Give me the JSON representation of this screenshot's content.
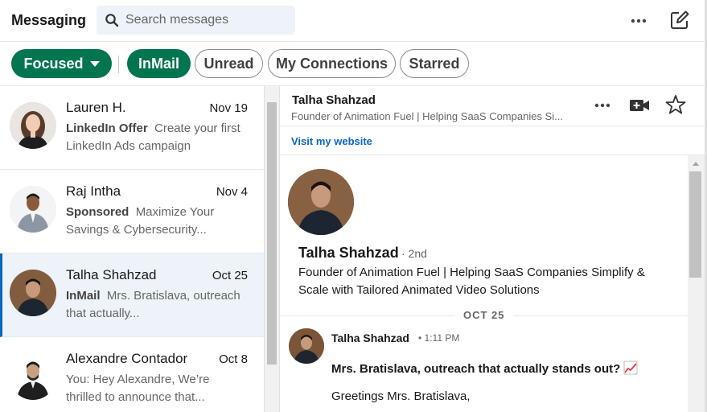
{
  "header": {
    "title": "Messaging",
    "search_placeholder": "Search messages",
    "more_icon": "ellipsis-icon",
    "compose_icon": "compose-icon"
  },
  "filters": {
    "focused": "Focused",
    "inmail": "InMail",
    "unread": "Unread",
    "my_connections": "My Connections",
    "starred": "Starred"
  },
  "conversations": [
    {
      "name": "Lauren H.",
      "date": "Nov 19",
      "tag": "LinkedIn Offer",
      "snippet": "Create your first LinkedIn Ads campaign"
    },
    {
      "name": "Raj Intha",
      "date": "Nov 4",
      "tag": "Sponsored",
      "snippet": "Maximize Your Savings & Cybersecurity..."
    },
    {
      "name": "Talha Shahzad",
      "date": "Oct 25",
      "tag": "InMail",
      "snippet": "Mrs. Bratislava, outreach that actually..."
    },
    {
      "name": "Alexandre Contador",
      "date": "Oct 8",
      "tag": "",
      "snippet": "You: Hey Alexandre,  We’re thrilled to announce that..."
    }
  ],
  "thread_header": {
    "name": "Talha Shahzad",
    "headline": "Founder of Animation Fuel | Helping SaaS Companies Si...",
    "website_link": "Visit my website"
  },
  "profile": {
    "name": "Talha Shahzad",
    "degree": "· 2nd",
    "headline": "Founder of Animation Fuel | Helping SaaS Companies Simplify & Scale with Tailored Animated Video Solutions"
  },
  "day_divider": "OCT 25",
  "message": {
    "sender": "Talha Shahzad",
    "time": "• 1:11 PM",
    "subject": "Mrs. Bratislava, outreach that actually stands out?",
    "body_first_line": "Greetings Mrs. Bratislava,"
  },
  "colors": {
    "accent_green": "#01754f",
    "link_blue": "#0a66c2",
    "active_row": "#edf3f8"
  }
}
